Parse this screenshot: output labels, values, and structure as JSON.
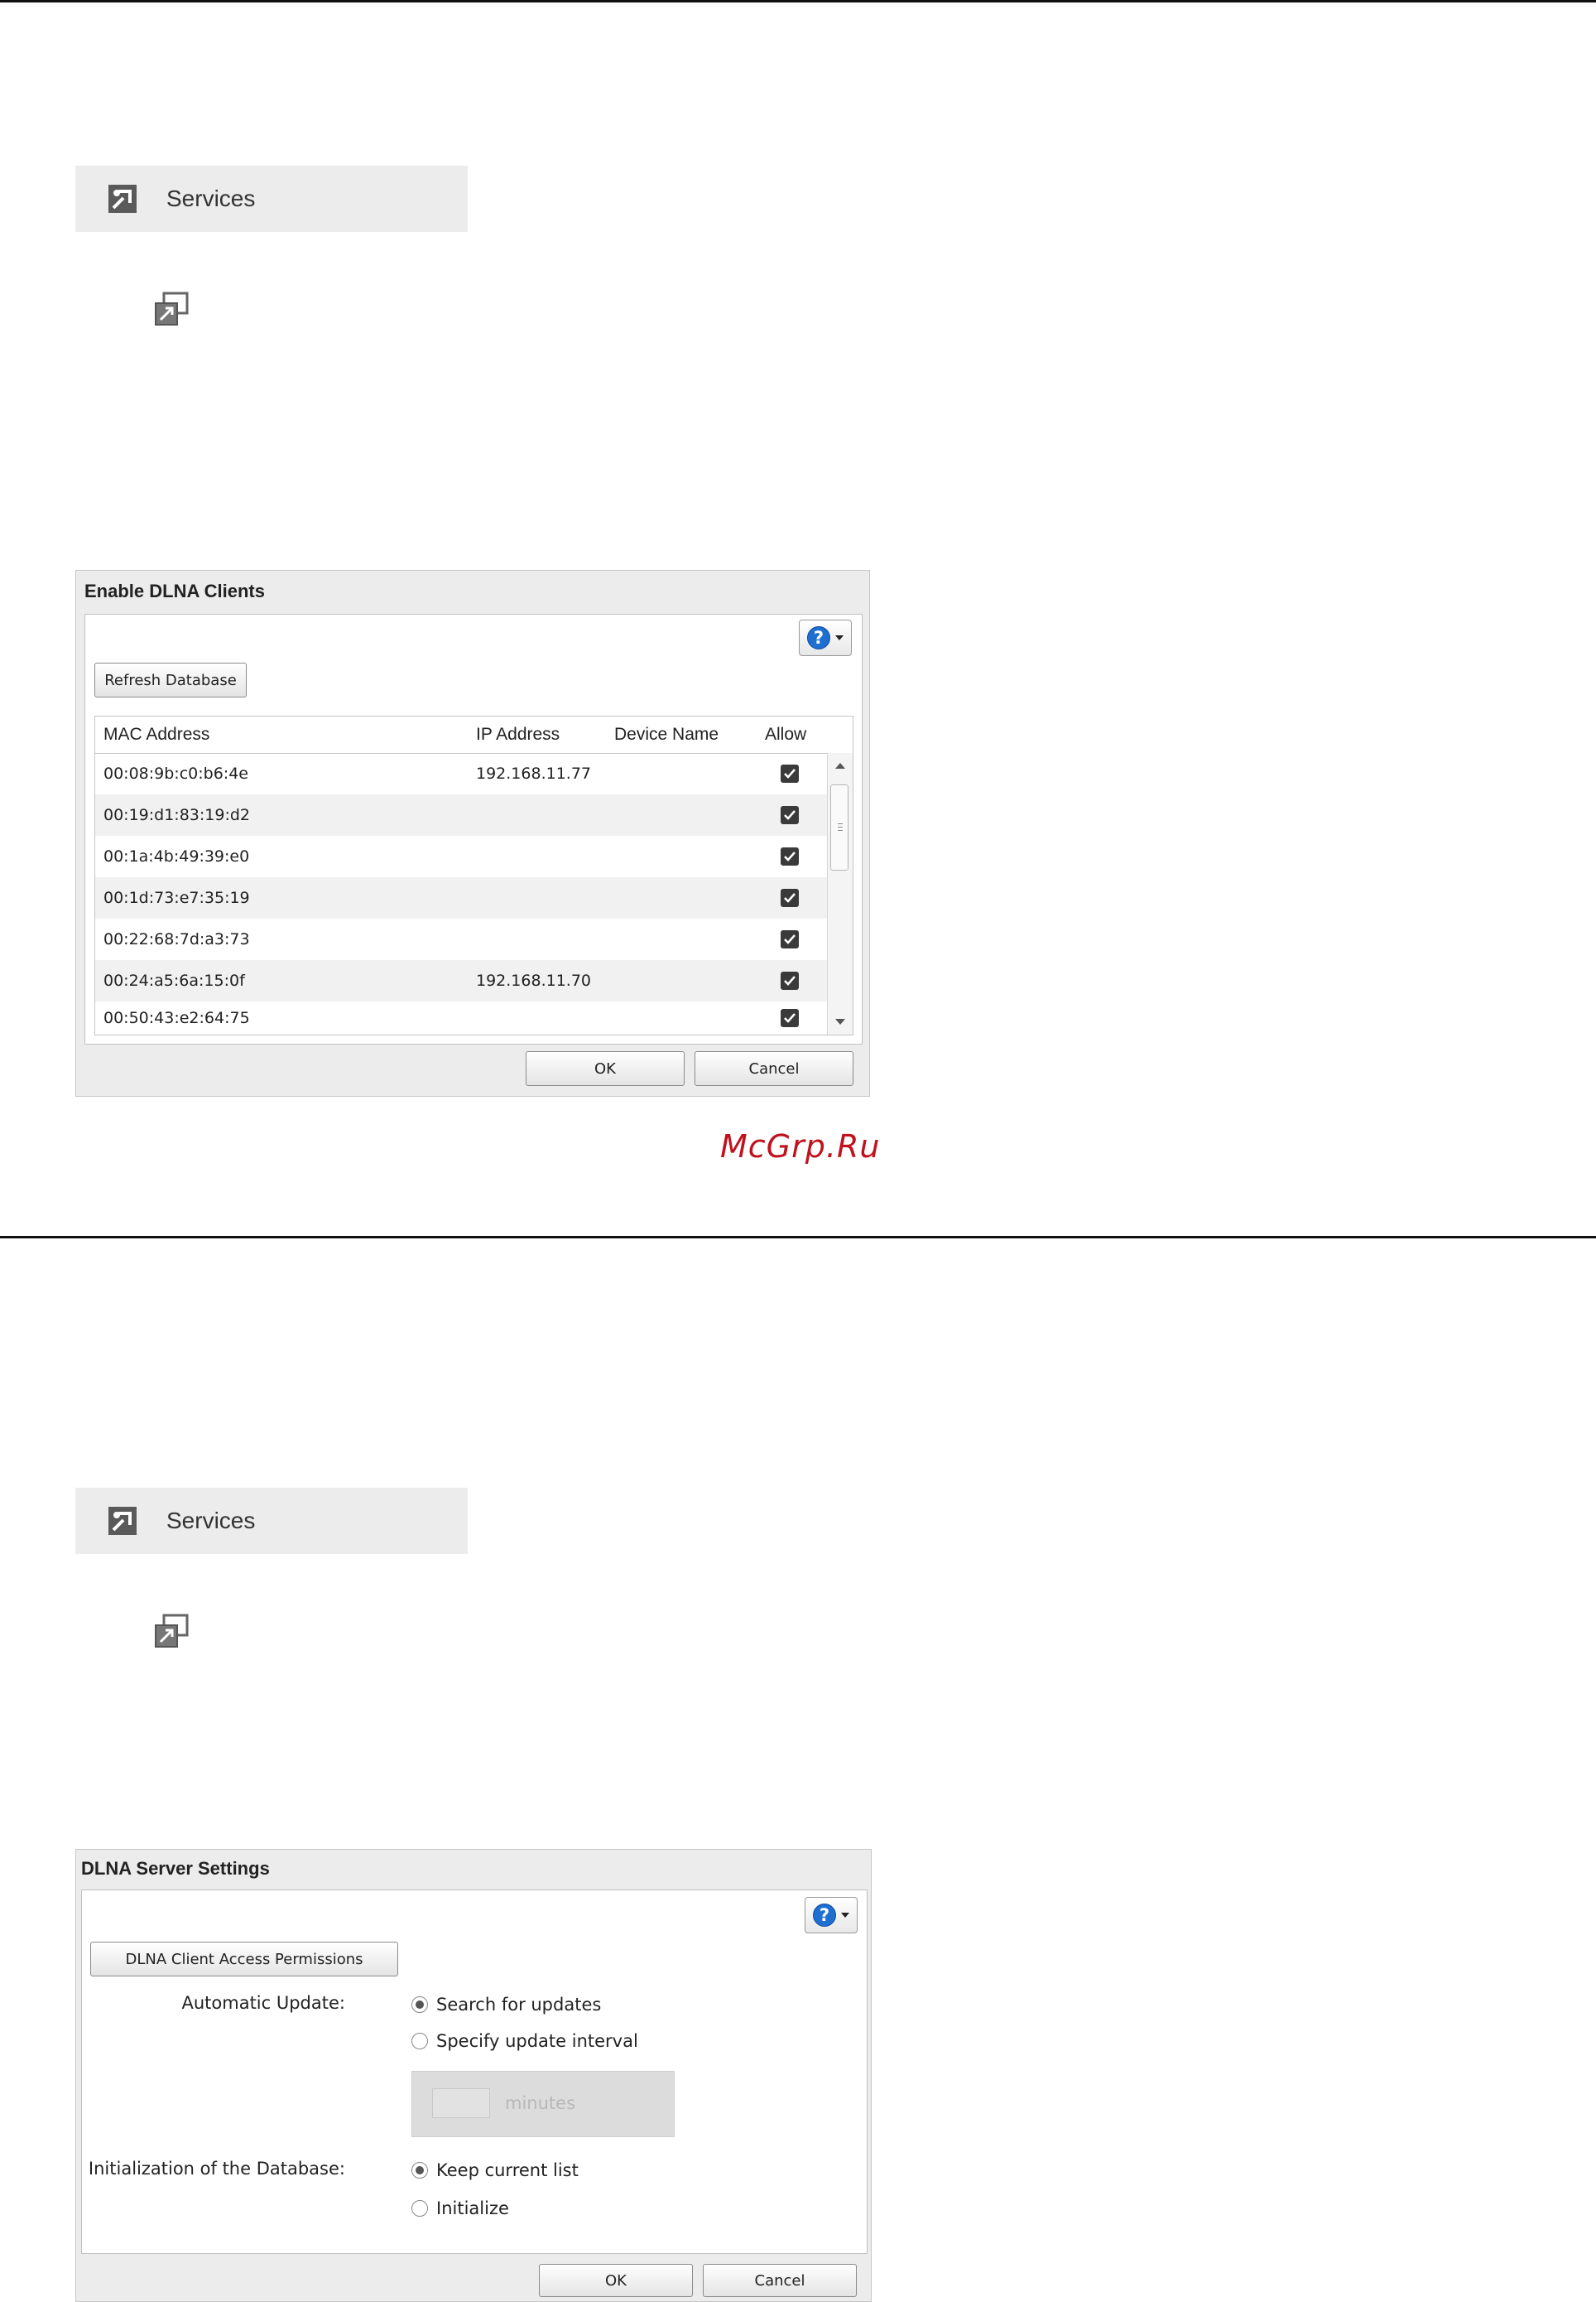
{
  "section1": {
    "services_label": "Services",
    "dialog": {
      "title": "Enable DLNA Clients",
      "refresh_button": "Refresh Database",
      "columns": [
        "MAC Address",
        "IP Address",
        "Device Name",
        "Allow"
      ],
      "rows": [
        {
          "mac": "00:08:9b:c0:b6:4e",
          "ip": "192.168.11.77",
          "device": "",
          "allow": true
        },
        {
          "mac": "00:19:d1:83:19:d2",
          "ip": "",
          "device": "",
          "allow": true
        },
        {
          "mac": "00:1a:4b:49:39:e0",
          "ip": "",
          "device": "",
          "allow": true
        },
        {
          "mac": "00:1d:73:e7:35:19",
          "ip": "",
          "device": "",
          "allow": true
        },
        {
          "mac": "00:22:68:7d:a3:73",
          "ip": "",
          "device": "",
          "allow": true
        },
        {
          "mac": "00:24:a5:6a:15:0f",
          "ip": "192.168.11.70",
          "device": "",
          "allow": true
        },
        {
          "mac": "00:50:43:e2:64:75",
          "ip": "",
          "device": "",
          "allow": true
        }
      ],
      "ok_button": "OK",
      "cancel_button": "Cancel"
    }
  },
  "watermark": "McGrp.Ru",
  "section2": {
    "services_label": "Services",
    "dialog": {
      "title": "DLNA Server Settings",
      "permissions_button": "DLNA Client Access Permissions",
      "auto_update_label": "Automatic Update:",
      "auto_update_options": [
        {
          "label": "Search for updates",
          "selected": true
        },
        {
          "label": "Specify update interval",
          "selected": false
        }
      ],
      "interval_unit": "minutes",
      "init_db_label": "Initialization of the Database:",
      "init_db_options": [
        {
          "label": "Keep current list",
          "selected": true
        },
        {
          "label": "Initialize",
          "selected": false
        }
      ],
      "ok_button": "OK",
      "cancel_button": "Cancel"
    }
  },
  "colors": {
    "help_blue": "#1f6fd1",
    "watermark_red": "#c0121d",
    "bar_gray": "#ececec"
  },
  "icons": [
    "services-icon",
    "external-link-icon",
    "help-icon",
    "dropdown-caret-icon",
    "checkbox-checked-icon",
    "scroll-up-icon",
    "scroll-down-icon"
  ]
}
